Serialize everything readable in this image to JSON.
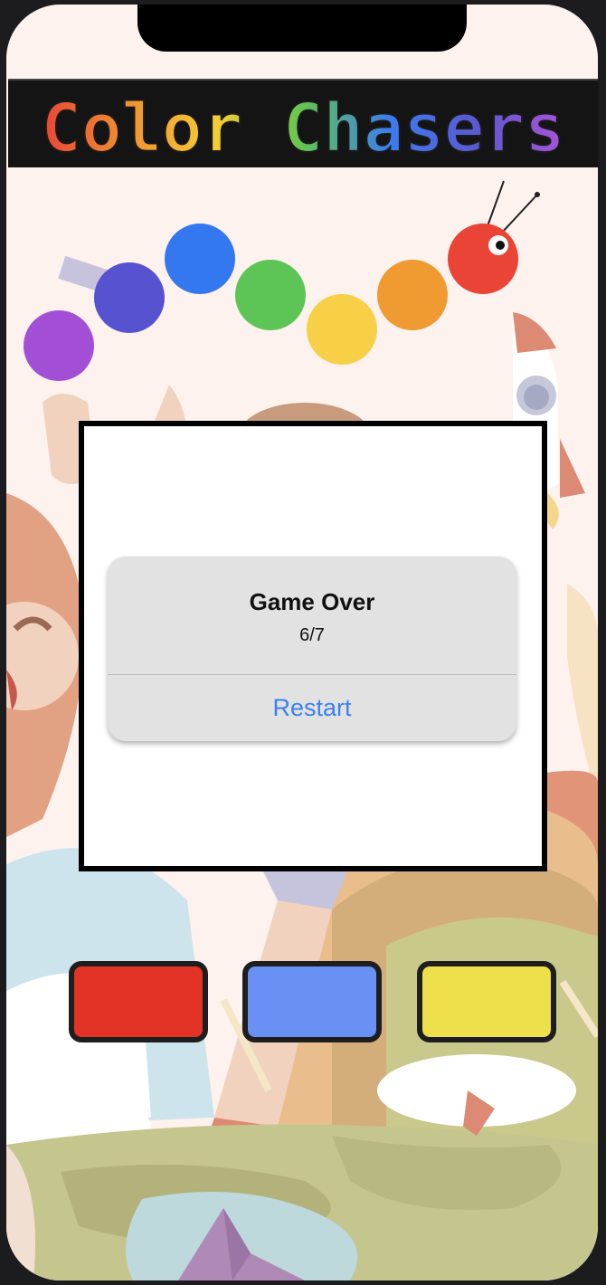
{
  "app": {
    "title": "Color Chasers"
  },
  "title_colors": [
    "#e84535",
    "#f09330",
    "#f6cd34",
    "#62c552",
    "#3b7cf0",
    "#5c58d0",
    "#a854d8"
  ],
  "caterpillar": {
    "segments": [
      "#a24fd6",
      "#5752d0",
      "#3478f0",
      "#5dc555",
      "#f8d048",
      "#f09a32"
    ],
    "head_color": "#ea4436"
  },
  "dialog": {
    "title": "Game Over",
    "message": "6/7",
    "button_label": "Restart",
    "button_color": "#3a82f0"
  },
  "color_buttons": [
    {
      "name": "red",
      "color": "#e33327"
    },
    {
      "name": "blue",
      "color": "#6890f5"
    },
    {
      "name": "yellow",
      "color": "#ede04a"
    }
  ]
}
